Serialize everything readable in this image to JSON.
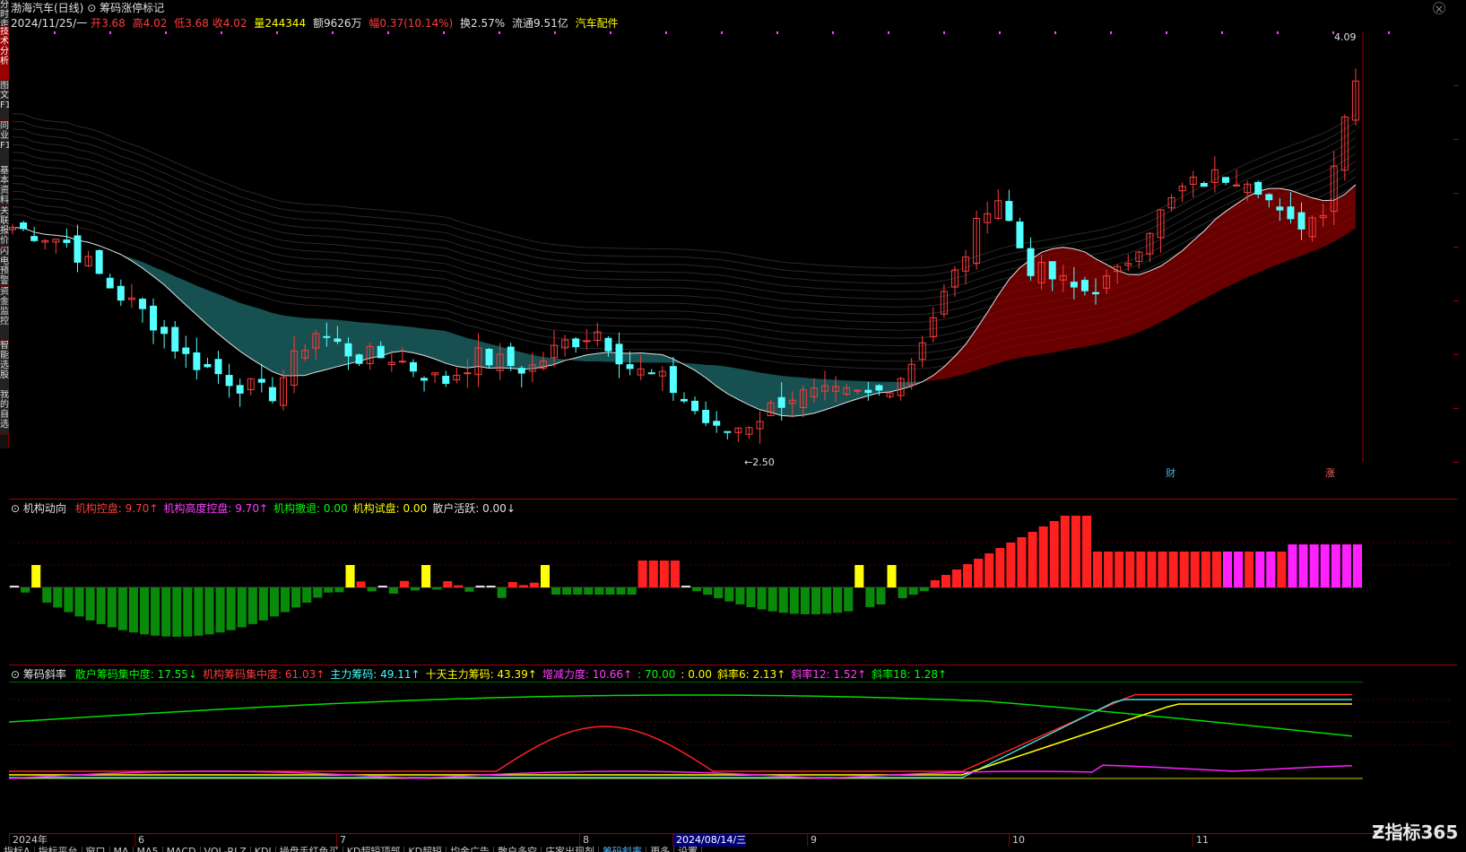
{
  "header": {
    "stock_title": "渤海汽车(日线)",
    "indicator_name": "筹码涨停标记",
    "date": "2024/11/25/一",
    "open_label": "开",
    "open": "3.68",
    "high_label": "高",
    "high": "4.02",
    "low_label": "低",
    "low": "3.68",
    "close_label": "收",
    "close": "4.02",
    "volume_label": "量",
    "volume": "244344",
    "amount_label": "额",
    "amount": "9626万",
    "change_label": "幅",
    "change": "0.37(10.14%)",
    "turnover_label": "换",
    "turnover": "2.57%",
    "float_label": "流通",
    "float": "9.51亿",
    "sector": "汽车配件"
  },
  "left_tabs": [
    "分时走势",
    "技术分析",
    "图文F10",
    "同业F10",
    "基本资料",
    "关联报价",
    "闪电预警",
    "资金监控",
    "智能选股",
    "我的自选"
  ],
  "main_chart": {
    "high_marker": "4.09",
    "low_marker": "2.50",
    "badge_fin": "财",
    "badge_up": "涨"
  },
  "panel2": {
    "name": "机构动向",
    "items": [
      {
        "label": "机构控盘:",
        "value": "9.70",
        "arrow": "↑",
        "color": "#ff3b3b"
      },
      {
        "label": "机构高度控盘:",
        "value": "9.70",
        "arrow": "↑",
        "color": "#ff40ff"
      },
      {
        "label": "机构撤退:",
        "value": "0.00",
        "arrow": "",
        "color": "#00ff00"
      },
      {
        "label": "机构试盘:",
        "value": "0.00",
        "arrow": "",
        "color": "#ffff00"
      },
      {
        "label": "散户活跃:",
        "value": "0.00",
        "arrow": "↓",
        "color": "#e0e0e0"
      }
    ]
  },
  "panel3": {
    "name": "筹码斜率",
    "items": [
      {
        "label": "散户筹码集中度:",
        "value": "17.55",
        "arrow": "↓",
        "color": "#00ff00"
      },
      {
        "label": "机构筹码集中度:",
        "value": "61.03",
        "arrow": "↑",
        "color": "#ff3b3b"
      },
      {
        "label": "主力筹码:",
        "value": "49.11",
        "arrow": "↑",
        "color": "#40ffff"
      },
      {
        "label": "十天主力筹码:",
        "value": "43.39",
        "arrow": "↑",
        "color": "#ffff00"
      },
      {
        "label": "增减力度:",
        "value": "10.66",
        "arrow": "↑",
        "color": "#ff40ff"
      },
      {
        "label": ":",
        "value": "70.00",
        "arrow": "",
        "color": "#00ff00"
      },
      {
        "label": ":",
        "value": "0.00",
        "arrow": "",
        "color": "#ffff00"
      },
      {
        "label": "斜率6:",
        "value": "2.13",
        "arrow": "↑",
        "color": "#ffff00"
      },
      {
        "label": "斜率12:",
        "value": "1.52",
        "arrow": "↑",
        "color": "#ff40ff"
      },
      {
        "label": "斜率18:",
        "value": "1.28",
        "arrow": "↑",
        "color": "#00ff00"
      }
    ]
  },
  "bottom_dates": [
    {
      "label": "2024年",
      "hl": false
    },
    {
      "label": "6",
      "hl": false
    },
    {
      "label": "7",
      "hl": false
    },
    {
      "label": "8",
      "hl": false
    },
    {
      "label": "2024/08/14/三",
      "hl": true
    },
    {
      "label": "9",
      "hl": false
    },
    {
      "label": "10",
      "hl": false
    },
    {
      "label": "11",
      "hl": false
    }
  ],
  "bottom_tabs": [
    "指标A",
    "指标平台",
    "窗口",
    "MA",
    "MA5",
    "MACD",
    "VOL-RLZ",
    "KDJ",
    "操盘手红色买",
    "KD超短顶部",
    "KD超短",
    "均金广告",
    "散户多空",
    "庄家出现剂",
    "筹码斜率",
    "更多",
    "设置"
  ],
  "logo": "指标365",
  "colors": {
    "up": "#ff3b3b",
    "down": "#54ffff",
    "ma_teal": "#1e6b6b",
    "ma_red": "#8b0000"
  }
}
